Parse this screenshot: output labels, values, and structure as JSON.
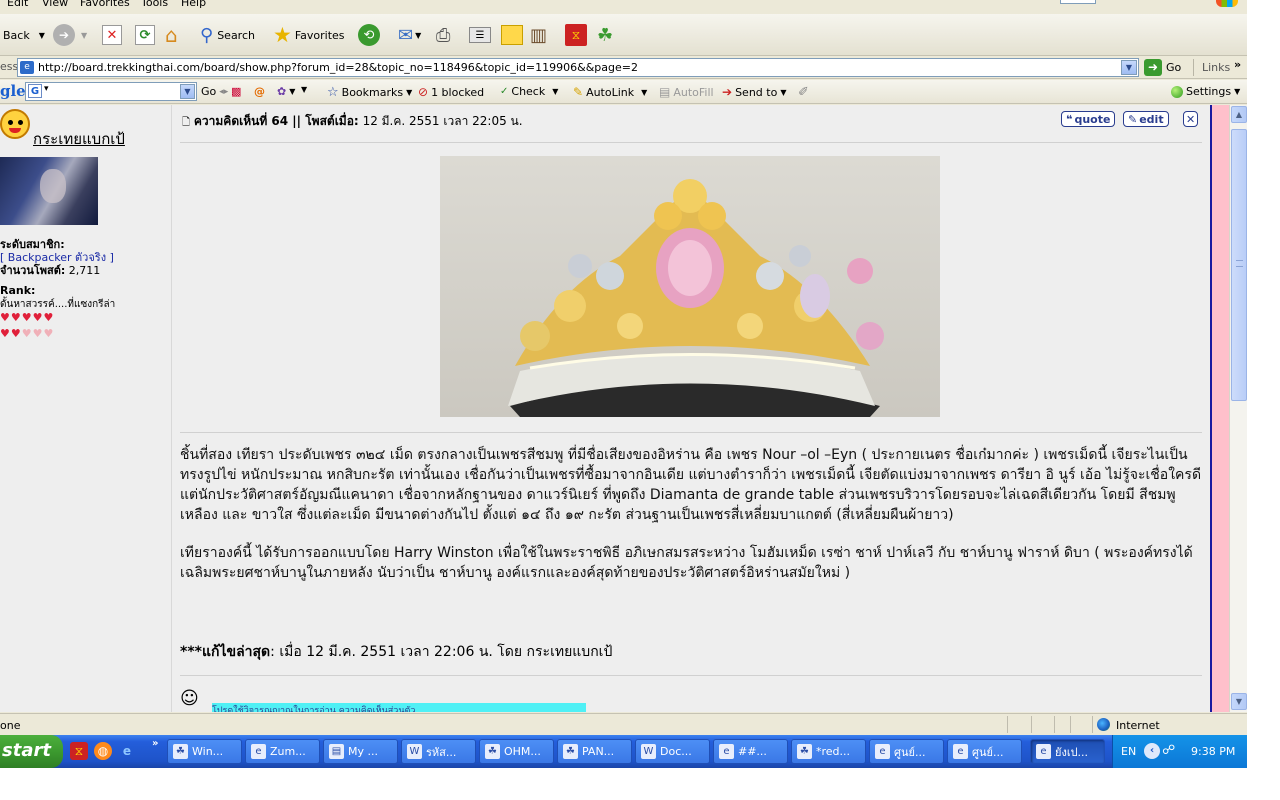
{
  "menu": {
    "items": [
      "Edit",
      "View",
      "Favorites",
      "Tools",
      "Help"
    ]
  },
  "toolbar": {
    "back_label": "Back",
    "search_label": "Search",
    "favorites_label": "Favorites",
    "icons": [
      "forward-icon",
      "stop-icon",
      "refresh-icon",
      "home-icon",
      "history-icon",
      "mail-icon",
      "print-icon",
      "edit-icon",
      "folder-icon",
      "research-icon",
      "messenger-icon",
      "people-icon"
    ]
  },
  "address": {
    "label": "ess",
    "url": "http://board.trekkingthai.com/board/show.php?forum_id=28&topic_no=118496&topic_id=119906&&page=2",
    "go_label": "Go",
    "links_label": "Links"
  },
  "google_toolbar": {
    "logo": "gle",
    "go_label": "Go",
    "bookmarks_label": "Bookmarks",
    "blocked_label": "1 blocked",
    "check_label": "Check",
    "autolink_label": "AutoLink",
    "autofill_label": "AutoFill",
    "sendto_label": "Send to",
    "settings_label": "Settings"
  },
  "sidebar": {
    "username": "กระเทยแบกเป้",
    "member_level_label": "ระดับสมาชิก:",
    "member_level_value": "[ Backpacker ตัวจริง ]",
    "post_count_label": "จำนวนโพสต์:",
    "post_count_value": "2,711",
    "rank_label": "Rank:",
    "rank_value": "ดั้นหาสวรรค์....ที่แซงกรีล่า",
    "hearts_row1": "♥♥♥♥♥",
    "hearts_row2": "♥♥♥♥♥"
  },
  "post": {
    "header_bold": "ความคิดเห็นที่ 64 || โพสต์เมื่อ:",
    "header_date": "12 มี.ค. 2551 เวลา 22:05 น.",
    "quote_label": "quote",
    "edit_label": "edit",
    "paragraph1": "ชิ้นที่สอง เทียรา ประดับเพชร ๓๒๔ เม็ด ตรงกลางเป็นเพชรสีชมพู ที่มีชื่อเสียงของอิหร่าน คือ เพชร Nour –ol –Eyn ( ประกายเนตร ชื่อเก๋มากค่ะ ) เพชรเม็ดนี้ เจียระไนเป็นทรงรูปไข่ หนักประมาณ หกสิบกะรัต เท่านั้นเอง  เชื่อกันว่าเป็นเพชรที่ซื้อมาจากอินเดีย แต่บางตำราก็ว่า เพชรเม็ดนี้ เจียตัดแบ่งมาจากเพชร ดารียา อิ นูร์ เอ้อ ไม่รู้จะเชื่อใครดี แต่นักประวัติศาสตร์อัญมณีแคนาดา เชื่อจากหลักฐานของ ดาแวร์นิเยร์ ที่พูดถึง Diamanta de grande table  ส่วนเพชรบริวารโดยรอบจะไล่เฉดสีเดียวกัน โดยมี สีชมพู เหลือง และ ขาวใส ซึ่งแต่ละเม็ด มีขนาดต่างกันไป ตั้งแต่ ๑๔ ถึง ๑๙ กะรัต ส่วนฐานเป็นเพชรสี่เหลี่ยมบาแกตต์ (สี่เหลี่ยมผืนผ้ายาว)",
    "paragraph2": "เทียราองค์นี้ ได้รับการออกแบบโดย Harry Winston เพื่อใช้ในพระราชพิธี อภิเษกสมรสระหว่าง  โมฮัมเหม็ด เรซ่า ชาห์ ปาห์เลวี กับ ชาห์บานู ฟาราห์ ดิบา ( พระองค์ทรงได้เฉลิมพระยศชาห์บานูในภายหลัง นับว่าเป็น ชาห์บานู องค์แรกและองค์สุดท้ายของประวัติศาสตร์อิหร่านสมัยใหม่ )",
    "edit_bold": "***แก้ไขล่าสุด",
    "edit_rest": ": เมื่อ 12 มี.ค. 2551 เวลา 22:06 น. โดย กระเทยแบกเป้",
    "signature": "โปรดใช้วิจารณญาณในการอ่าน ความคิดเห็นส่วนตัว"
  },
  "status": {
    "text": "one",
    "zone": "Internet"
  },
  "taskbar": {
    "start_label": "start",
    "tasks": [
      {
        "label": "Win...",
        "icon": "☘"
      },
      {
        "label": "Zum...",
        "icon": "e"
      },
      {
        "label": "My ...",
        "icon": "▤"
      },
      {
        "label": "รหัส...",
        "icon": "W"
      },
      {
        "label": "OHM...",
        "icon": "☘"
      },
      {
        "label": "PAN...",
        "icon": "☘"
      },
      {
        "label": "Doc...",
        "icon": "W"
      },
      {
        "label": "##...",
        "icon": "e"
      },
      {
        "label": "*red...",
        "icon": "☘"
      },
      {
        "label": "ศูนย์...",
        "icon": "e"
      },
      {
        "label": "ศูนย์...",
        "icon": "e"
      },
      {
        "label": "ยังเป...",
        "icon": "e"
      }
    ],
    "lang": "EN",
    "clock": "9:38 PM"
  }
}
